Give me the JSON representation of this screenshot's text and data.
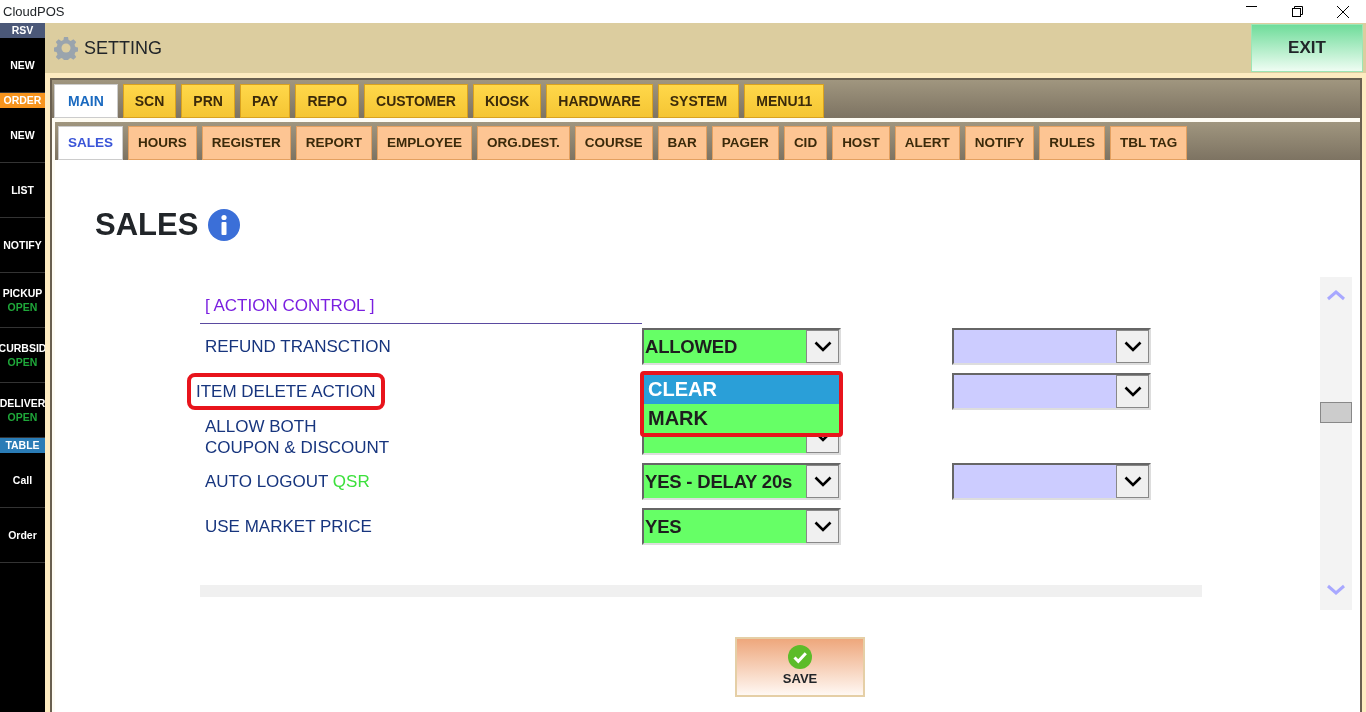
{
  "window": {
    "title": "CloudPOS"
  },
  "sidebar": {
    "sections": [
      {
        "header": "RSV",
        "color": "#4b5878",
        "items": [
          {
            "label": "NEW"
          }
        ]
      },
      {
        "header": "ORDER",
        "color": "#f7941d",
        "items": [
          {
            "label": "NEW"
          },
          {
            "label": "LIST"
          },
          {
            "label": "NOTIFY"
          },
          {
            "label": "PICKUP",
            "status": "OPEN"
          },
          {
            "label": "CURBSID",
            "status": "OPEN"
          },
          {
            "label": "DELIVER",
            "status": "OPEN"
          }
        ]
      },
      {
        "header": "TABLE",
        "color": "#2a7cb6",
        "items": [
          {
            "label": "Call"
          },
          {
            "label": "Order"
          }
        ]
      }
    ]
  },
  "header": {
    "title": "SETTING",
    "exit_button": "EXIT"
  },
  "tabs": [
    {
      "label": "MAIN",
      "selected": true
    },
    {
      "label": "SCN",
      "selected": false
    },
    {
      "label": "PRN",
      "selected": false
    },
    {
      "label": "PAY",
      "selected": false
    },
    {
      "label": "REPO",
      "selected": false
    },
    {
      "label": "CUSTOMER",
      "selected": false
    },
    {
      "label": "KIOSK",
      "selected": false
    },
    {
      "label": "HARDWARE",
      "selected": false
    },
    {
      "label": "SYSTEM",
      "selected": false
    },
    {
      "label": "MENU11",
      "selected": false
    }
  ],
  "subtabs": [
    {
      "label": "SALES",
      "selected": true
    },
    {
      "label": "HOURS",
      "selected": false
    },
    {
      "label": "REGISTER",
      "selected": false
    },
    {
      "label": "REPORT",
      "selected": false
    },
    {
      "label": "EMPLOYEE",
      "selected": false
    },
    {
      "label": "ORG.DEST.",
      "selected": false
    },
    {
      "label": "COURSE",
      "selected": false
    },
    {
      "label": "BAR",
      "selected": false
    },
    {
      "label": "PAGER",
      "selected": false
    },
    {
      "label": "CID",
      "selected": false
    },
    {
      "label": "HOST",
      "selected": false
    },
    {
      "label": "ALERT",
      "selected": false
    },
    {
      "label": "NOTIFY",
      "selected": false
    },
    {
      "label": "RULES",
      "selected": false
    },
    {
      "label": "TBL TAG",
      "selected": false
    }
  ],
  "page": {
    "title": "SALES"
  },
  "section": {
    "title": "[ ACTION CONTROL ]",
    "rows": [
      {
        "label": "REFUND TRANSCTION",
        "value": "ALLOWED",
        "secondary": true,
        "highlighted": false
      },
      {
        "label": "ITEM DELETE ACTION",
        "secondary": true,
        "highlighted": true,
        "open_options": [
          {
            "label": "CLEAR",
            "selected": true
          },
          {
            "label": "MARK",
            "selected": false
          }
        ]
      },
      {
        "label": "ALLOW BOTH\nCOUPON & DISCOUNT",
        "highlighted": false
      },
      {
        "label": "AUTO LOGOUT",
        "tag": "QSR",
        "value": "YES - DELAY 20s",
        "secondary": true,
        "highlighted": false
      },
      {
        "label": "USE MARKET PRICE",
        "value": "YES",
        "highlighted": false
      }
    ]
  },
  "save_button": "SAVE"
}
